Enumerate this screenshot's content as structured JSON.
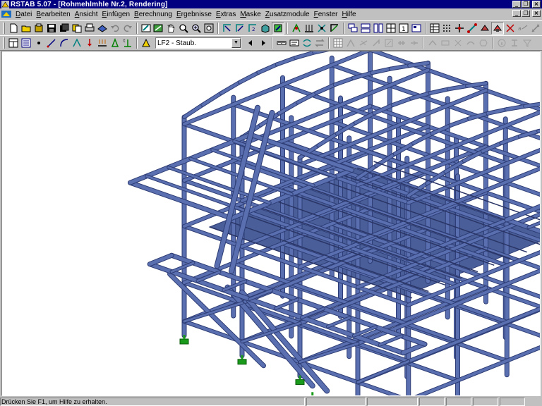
{
  "window": {
    "title": "RSTAB 5.07 - [Rohmehlmhle Nr.2, Rendering]"
  },
  "menu": {
    "items": [
      "Datei",
      "Bearbeiten",
      "Ansicht",
      "Einfügen",
      "Berechnung",
      "Ergebnisse",
      "Extras",
      "Maske",
      "Zusatzmodule",
      "Fenster",
      "Hilfe"
    ]
  },
  "toolbar": {
    "load_case": "LF2 - Staub."
  },
  "status": {
    "message": "Drücken Sie F1, um Hilfe zu erhalten."
  },
  "colors": {
    "title_bar": "#000080",
    "member": "#5a6fb0",
    "member_dark": "#2e3d75",
    "support": "#1a9a1a",
    "slab": "#4a5f9a"
  },
  "icons": [
    "new-icon",
    "open-icon",
    "save-icon",
    "print-icon",
    "undo-icon",
    "redo-icon",
    "pan-icon",
    "zoom-icon",
    "render-icon",
    "prev-icon",
    "next-icon"
  ]
}
